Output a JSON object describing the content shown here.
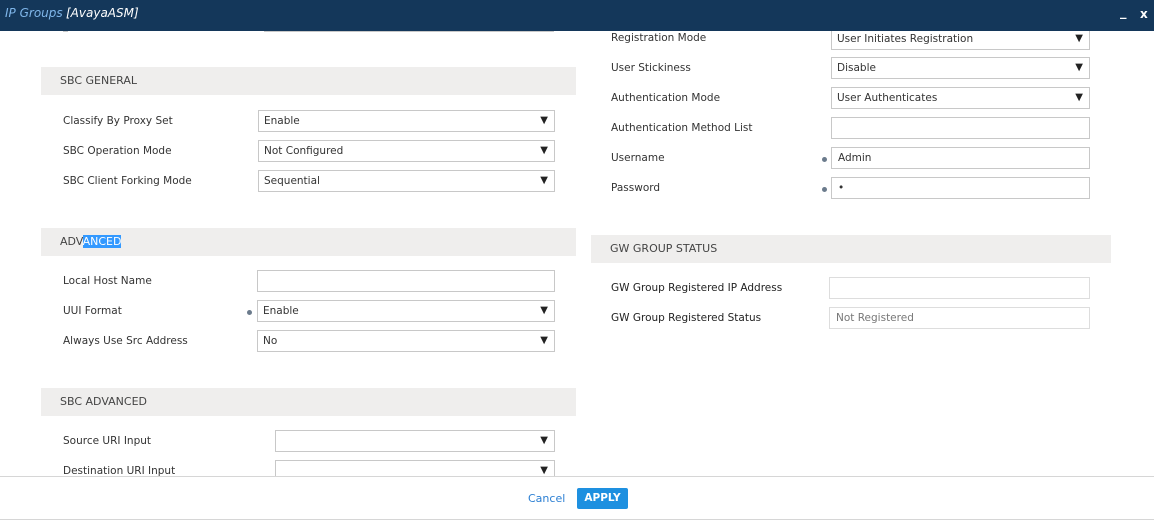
{
  "window": {
    "title": "IP Groups",
    "subtitle": "[AvayaASM]",
    "minimize_label": "_",
    "close_label": "x"
  },
  "sections": {
    "sbc_general": {
      "title": "SBC GENERAL",
      "classify_by_proxy_set": {
        "label": "Classify By Proxy Set",
        "value": "Enable"
      },
      "sbc_operation_mode": {
        "label": "SBC Operation Mode",
        "value": "Not Configured"
      },
      "sbc_client_forking_mode": {
        "label": "SBC Client Forking Mode",
        "value": "Sequential"
      }
    },
    "advanced": {
      "title_plain": "ADV",
      "title_selected": "ANCED",
      "local_host_name": {
        "label": "Local Host Name",
        "value": ""
      },
      "uui_format": {
        "label": "UUI Format",
        "value": "Enable"
      },
      "always_use_src_address": {
        "label": "Always Use Src Address",
        "value": "No"
      }
    },
    "sbc_advanced": {
      "title": "SBC ADVANCED",
      "source_uri_input": {
        "label": "Source URI Input",
        "value": ""
      },
      "destination_uri_input": {
        "label": "Destination URI Input",
        "value": ""
      }
    },
    "registration": {
      "registration_mode": {
        "label": "Registration Mode",
        "value": "User Initiates Registration"
      },
      "user_stickiness": {
        "label": "User Stickiness",
        "value": "Disable"
      },
      "authentication_mode": {
        "label": "Authentication Mode",
        "value": "User Authenticates"
      },
      "authentication_method_list": {
        "label": "Authentication Method List",
        "value": ""
      },
      "username": {
        "label": "Username",
        "value": "Admin"
      },
      "password": {
        "label": "Password",
        "value": "•"
      }
    },
    "gw_group_status": {
      "title": "GW GROUP STATUS",
      "registered_ip": {
        "label": "GW Group Registered IP Address",
        "value": ""
      },
      "registered_status": {
        "label": "GW Group Registered Status",
        "value": "Not Registered"
      }
    }
  },
  "footer": {
    "cancel_label": "Cancel",
    "apply_label": "APPLY"
  },
  "colors": {
    "titlebar": "#14375a",
    "title_accent": "#7fb6ea",
    "section_bg": "#efeeed",
    "apply_bg": "#1e90e0",
    "link": "#2b7fd3",
    "selection": "#3399ff"
  }
}
